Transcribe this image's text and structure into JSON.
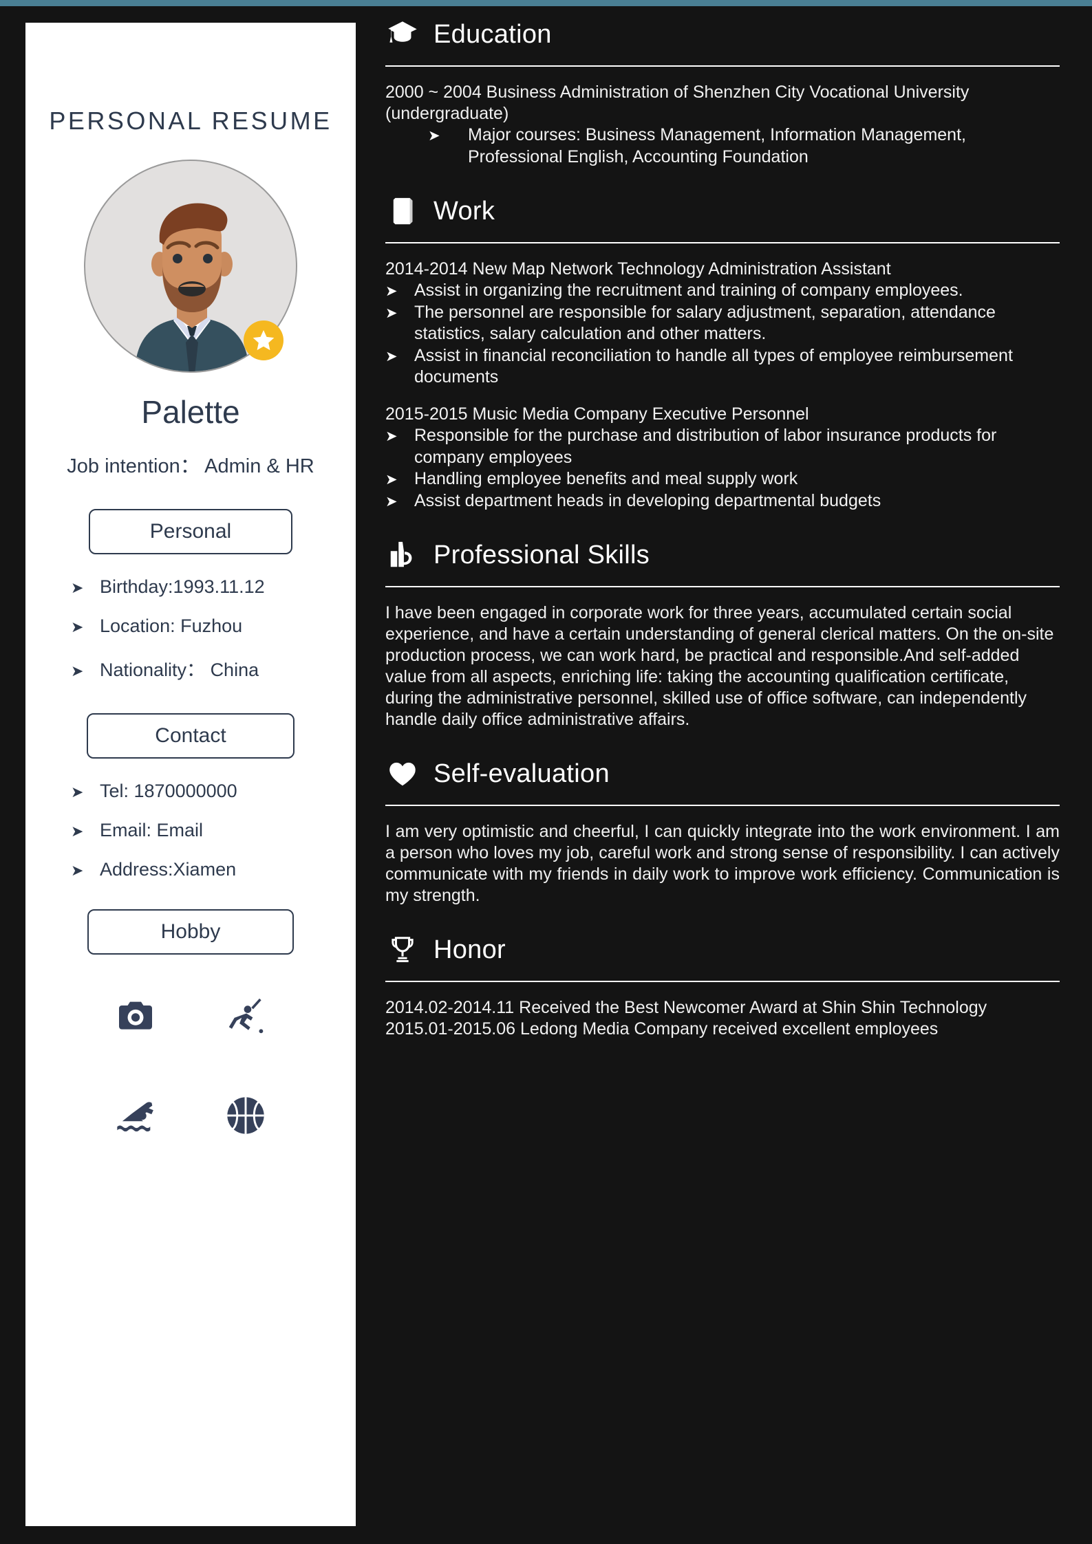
{
  "document": {
    "title": "PERSONAL RESUME"
  },
  "sidebar": {
    "heading": "PERSONAL RESUME",
    "avatar_icon": "avatar-photo",
    "badge_icon": "star-badge-icon",
    "name": "Palette",
    "job_intention": "Job intention： Admin & HR",
    "personal": {
      "pill_label": "Personal",
      "items": [
        "Birthday:1993.11.12",
        "Location: Fuzhou",
        "Nationality： China"
      ]
    },
    "contact": {
      "pill_label": "Contact",
      "items": [
        "Tel: 1870000000",
        "Email: Email",
        "Address:Xiamen"
      ]
    },
    "hobby": {
      "pill_label": "Hobby",
      "icons": [
        "camera-icon",
        "golf-icon",
        "swimming-icon",
        "basketball-icon"
      ]
    },
    "bullet_glyph": "➤"
  },
  "sections": {
    "education": {
      "icon": "graduation-cap-icon",
      "title": "Education",
      "entry": "2000 ~ 2004 Business Administration of Shenzhen City Vocational University (undergraduate)",
      "bullets": [
        "Major courses: Business Management, Information Management, Professional English, Accounting Foundation"
      ]
    },
    "work": {
      "icon": "book-icon",
      "title": "Work",
      "jobs": [
        {
          "title": "2014-2014 New Map Network Technology Administration Assistant",
          "bullets": [
            "Assist in organizing the recruitment and training of company employees.",
            "The personnel are responsible for salary adjustment, separation, attendance statistics, salary calculation and other matters.",
            "Assist in financial reconciliation to handle all types of employee reimbursement documents"
          ]
        },
        {
          "title": "2015-2015 Music Media Company Executive Personnel",
          "bullets": [
            "Responsible for the purchase and distribution of labor insurance products for company employees",
            "Handling employee benefits and meal supply work",
            "Assist department heads in developing departmental budgets"
          ]
        }
      ]
    },
    "skills": {
      "icon": "toolbox-icon",
      "title": "Professional Skills",
      "text": "I have been engaged in corporate work for three years, accumulated certain social experience, and have a certain understanding of general clerical matters. On the on-site production process, we can work hard, be practical and responsible.And self-added value from all aspects, enriching life: taking the accounting qualification certificate,   during the administrative personnel, skilled use of office software, can independently handle daily office administrative affairs."
    },
    "self_evaluation": {
      "icon": "heart-icon",
      "title": "Self-evaluation",
      "text": "I am very optimistic and cheerful, I can quickly integrate into the work environment. I am a person who loves my job, careful work and strong sense of responsibility. I can actively communicate with my friends in daily work to improve work efficiency. Communication is my strength."
    },
    "honor": {
      "icon": "trophy-icon",
      "title": "Honor",
      "lines": [
        "2014.02-2014.11 Received the Best Newcomer Award at Shin Shin Technology",
        "2015.01-2015.06 Ledong Media Company received excellent employees"
      ]
    }
  },
  "colors": {
    "dark_bg": "#141414",
    "card_bg": "#ffffff",
    "accent_navy": "#2e3a4d",
    "top_strip": "#4a7f94",
    "badge_gold": "#f5b820"
  }
}
